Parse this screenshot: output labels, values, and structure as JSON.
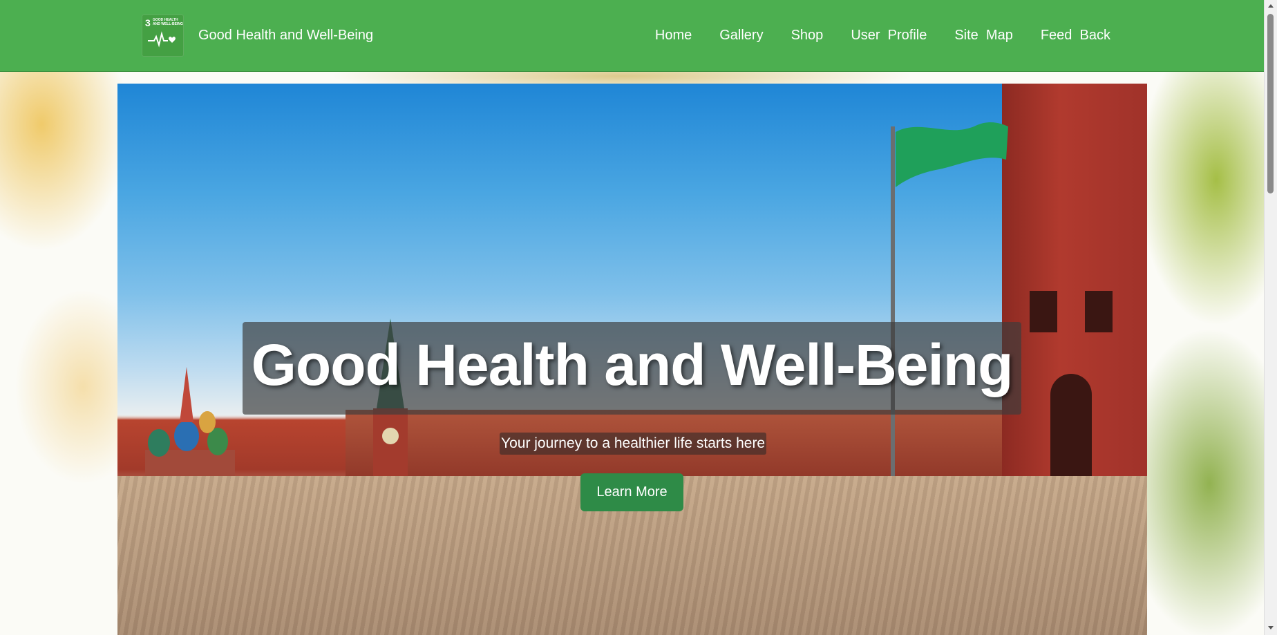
{
  "navbar": {
    "logo": {
      "number": "3",
      "text": "GOOD HEALTH AND WELL-BEING",
      "icon": "heartbeat-icon"
    },
    "brand": "Good Health and Well-Being",
    "links": [
      "Home",
      "Gallery",
      "Shop",
      "User  Profile",
      "Site  Map",
      "Feed  Back"
    ]
  },
  "hero": {
    "title": "Good Health and Well-Being",
    "subtitle": "Your journey to a healthier life starts here",
    "button": "Learn More"
  },
  "colors": {
    "navbar": "#4caf50",
    "button": "#2e8b47",
    "title_box": "rgba(60,60,60,0.68)"
  }
}
